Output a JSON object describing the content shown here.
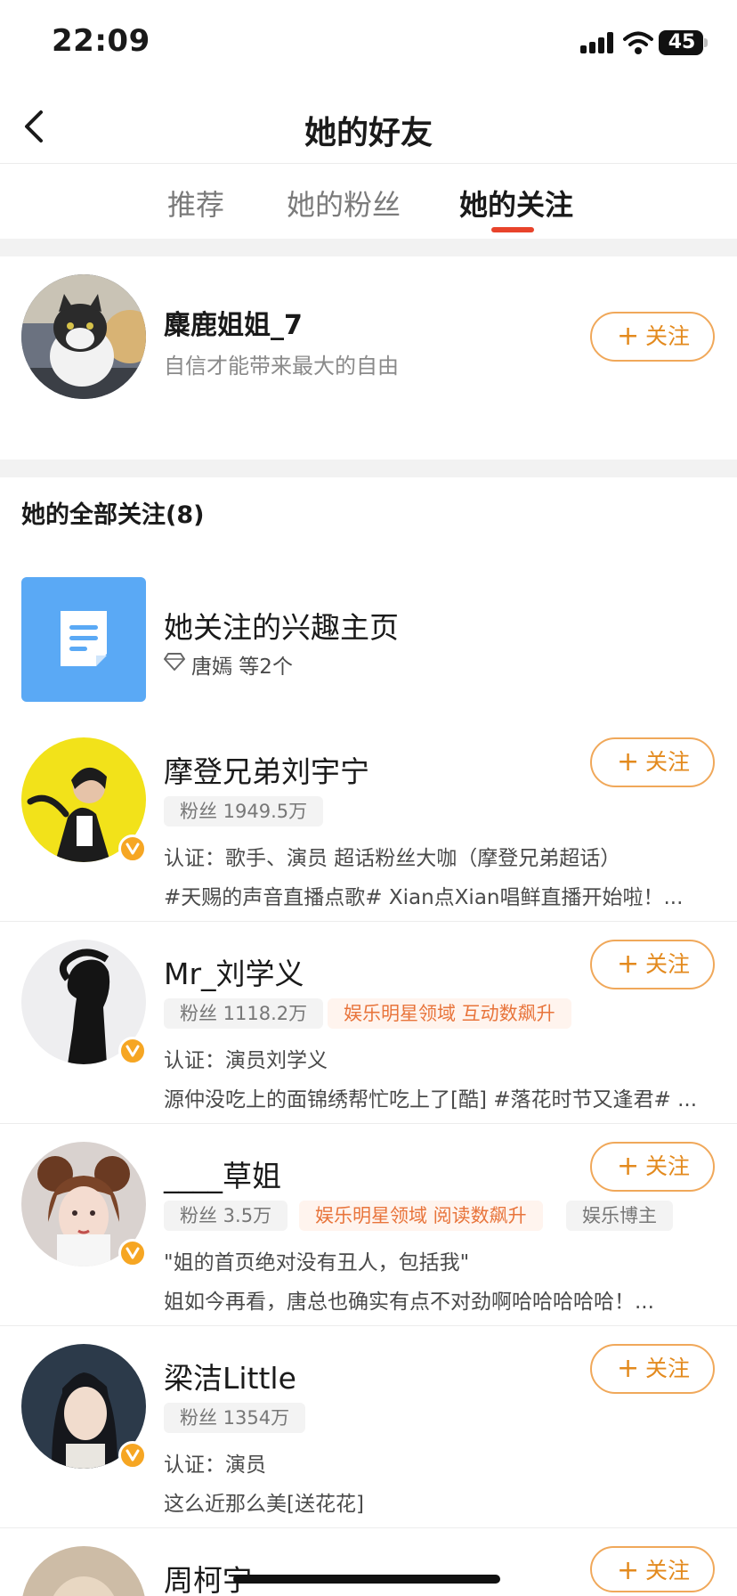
{
  "status": {
    "time": "22:09",
    "battery": "45"
  },
  "nav": {
    "title": "她的好友"
  },
  "tabs": [
    {
      "label": "推荐"
    },
    {
      "label": "她的粉丝"
    },
    {
      "label": "她的关注"
    }
  ],
  "featured": {
    "name": "麋鹿姐姐_7",
    "bio": "自信才能带来最大的自由",
    "follow_label": "关注"
  },
  "section": {
    "title": "她的全部关注(8)"
  },
  "interest": {
    "title": "她关注的兴趣主页",
    "subtitle": "唐嫣 等2个"
  },
  "follows": [
    {
      "name": "摩登兄弟刘宇宁",
      "fans": "粉丝 1949.5万",
      "tags": [],
      "line1": "认证：歌手、演员 超话粉丝大咖（摩登兄弟超话）",
      "line2": "#天赐的声音直播点歌# Xian点Xian唱鲜直播开始啦！...",
      "follow_label": "关注"
    },
    {
      "name": "Mr_刘学义",
      "fans": "粉丝 1118.2万",
      "tags": [
        "娱乐明星领域 互动数飙升"
      ],
      "line1": "认证：演员刘学义",
      "line2": "源仲没吃上的面锦绣帮忙吃上了[酷] #落花时节又逢君# ...",
      "follow_label": "关注"
    },
    {
      "name": "____草姐",
      "fans": "粉丝 3.5万",
      "tags": [
        "娱乐明星领域 阅读数飙升",
        "娱乐博主"
      ],
      "line1": "\"姐的首页绝对没有丑人，包括我\"",
      "line2": "姐如今再看，唐总也确实有点不对劲啊哈哈哈哈哈！...",
      "follow_label": "关注"
    },
    {
      "name": "梁洁Little",
      "fans": "粉丝 1354万",
      "tags": [],
      "line1": "认证：演员",
      "line2": "这么近那么美[送花花]",
      "follow_label": "关注"
    },
    {
      "name": "周柯宇",
      "follow_label": "关注"
    }
  ],
  "colors": {
    "accent": "#e38a1e",
    "tab_indicator": "#e8432b",
    "verify_badge": "#f6a623",
    "tag_orange": "#e8743b"
  }
}
